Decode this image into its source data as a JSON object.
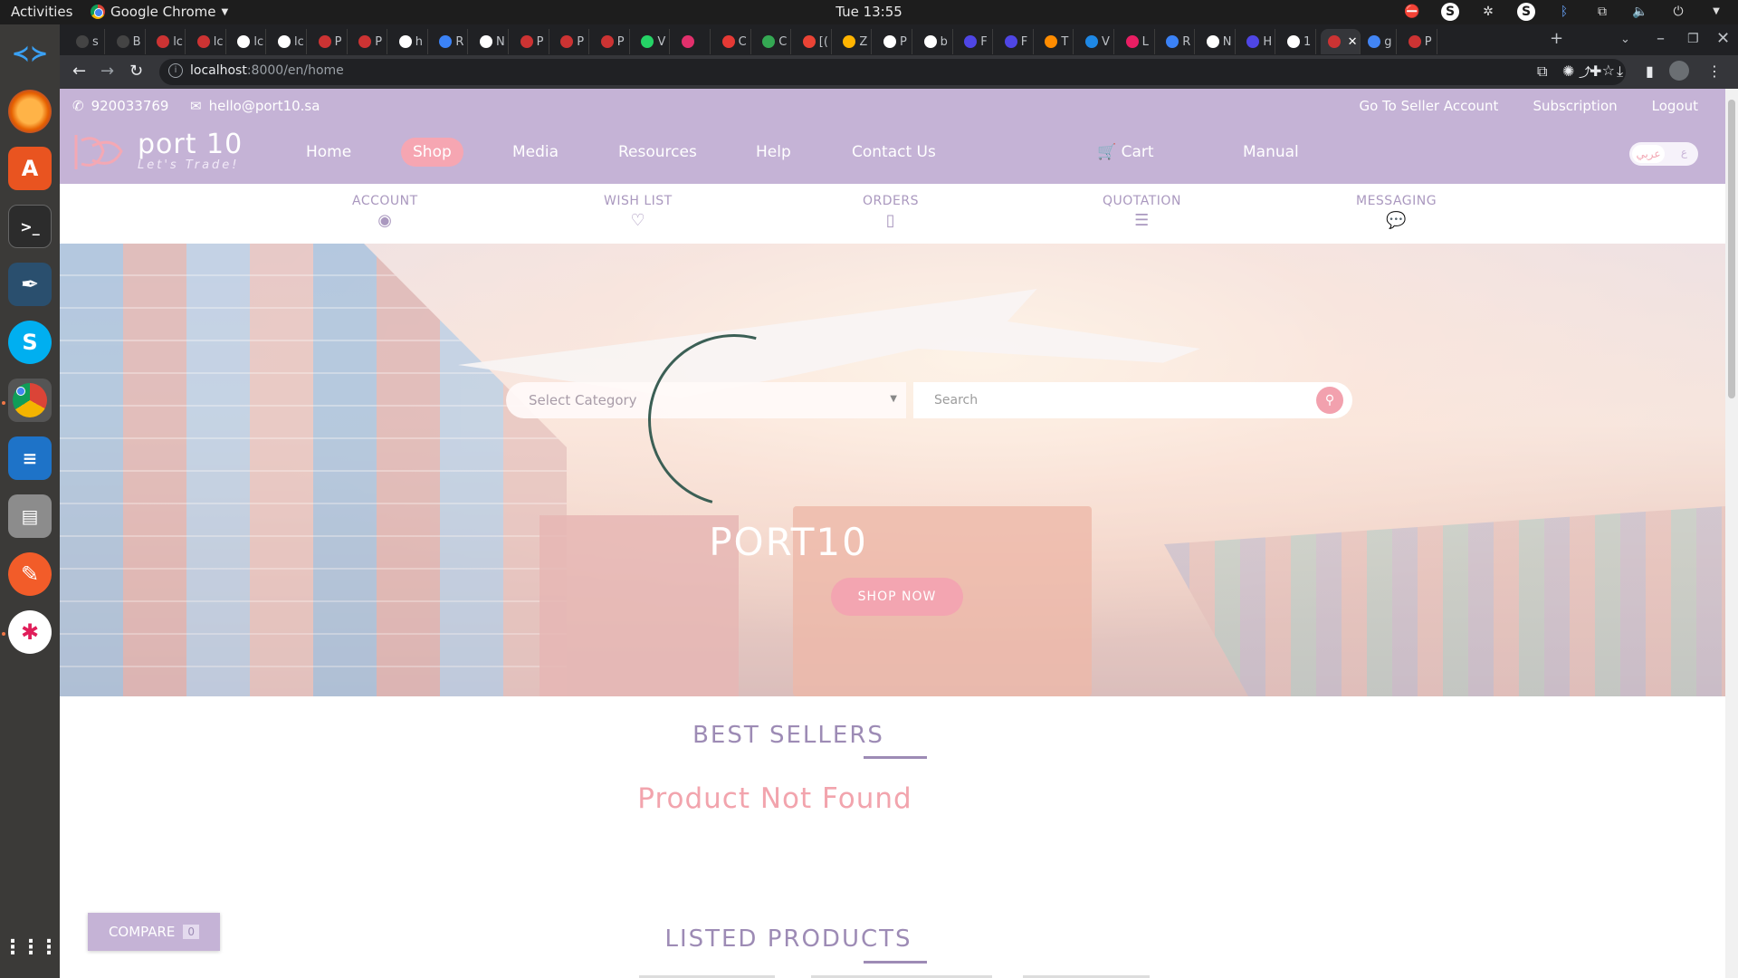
{
  "system": {
    "activities": "Activities",
    "app_name": "Google Chrome",
    "clock": "Tue 13:55"
  },
  "browser": {
    "tabs": [
      "s",
      "B",
      "lc",
      "lc",
      "lc",
      "lc",
      "P",
      "P",
      "h",
      "R",
      "N",
      "P",
      "P",
      "P",
      "V",
      "",
      "C",
      "C",
      "[(",
      "Z",
      "P",
      "b",
      "F",
      "F",
      "T",
      "V",
      "L",
      "R",
      "N",
      "H",
      "1",
      "",
      "g",
      "P"
    ],
    "url_host": "localhost",
    "url_path": ":8000/en/home"
  },
  "site": {
    "phone": "920033769",
    "email": "hello@port10.sa",
    "top_links": [
      "Go To Seller Account",
      "Subscription",
      "Logout"
    ],
    "logo": {
      "name": "port 10",
      "tagline": "Let's Trade!"
    },
    "nav": {
      "home": "Home",
      "shop": "Shop",
      "media": "Media",
      "resources": "Resources",
      "help": "Help",
      "contact": "Contact Us",
      "cart": "Cart",
      "manual": "Manual"
    },
    "lang_toggle": {
      "ar": "ع",
      "alt": "عربي"
    },
    "subnav": {
      "account": "ACCOUNT",
      "wishlist": "WISH LIST",
      "orders": "ORDERS",
      "quotation": "QUOTATION",
      "messaging": "MESSAGING"
    },
    "search": {
      "category_placeholder": "Select Category",
      "placeholder": "Search"
    },
    "hero": {
      "title": "PORT10",
      "cta": "SHOP NOW"
    },
    "best_sellers": {
      "title": "BEST SELLERS",
      "empty": "Product Not Found"
    },
    "listed_products": {
      "title": "LISTED PRODUCTS"
    },
    "compare": {
      "label": "COMPARE",
      "count": "0"
    }
  },
  "colors": {
    "brand_purple": "#c5b3d6",
    "brand_pink": "#f3a5b1",
    "heading": "#9d8bb5"
  }
}
